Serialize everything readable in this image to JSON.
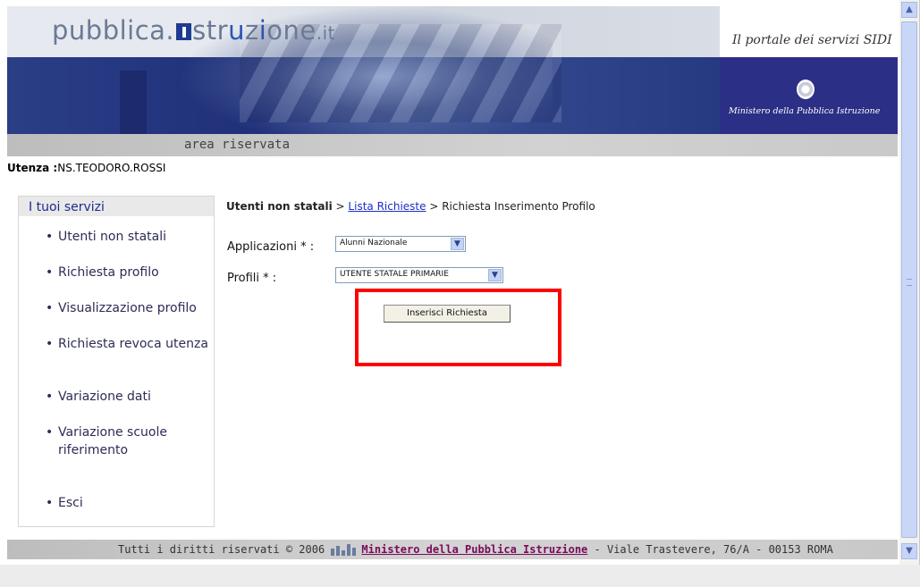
{
  "header": {
    "logo": {
      "part1": "pubblica.",
      "part2": "str",
      "part3": "u",
      "part4": "z",
      "part5": "i",
      "part6": "one",
      "tld": ".it"
    },
    "portal_tagline": "Il portale dei servizi SIDI",
    "ministry_signature": "Ministero della Pubblica Istruzione",
    "area_label": "area riservata"
  },
  "user": {
    "label": "Utenza :",
    "value": "NS.TEODORO.ROSSI"
  },
  "sidebar": {
    "title": "I tuoi servizi",
    "items": [
      {
        "label": "Utenti non statali"
      },
      {
        "label": "Richiesta profilo"
      },
      {
        "label": "Visualizzazione profilo"
      },
      {
        "label": "Richiesta revoca utenza"
      },
      {
        "label": "Variazione dati"
      },
      {
        "label": "Variazione scuole riferimento"
      },
      {
        "label": "Esci"
      }
    ]
  },
  "breadcrumb": {
    "root": "Utenti non statali",
    "sep1": " > ",
    "link": "Lista Richieste",
    "sep2": " > ",
    "current": "Richiesta Inserimento Profilo"
  },
  "form": {
    "applicazioni_label": "Applicazioni * :",
    "applicazioni_value": "Alunni Nazionale",
    "profili_label": "Profili * :",
    "profili_value": "UTENTE STATALE PRIMARIE",
    "submit_label": "Inserisci Richiesta"
  },
  "footer": {
    "copyright": "Tutti i diritti riservati © 2006",
    "ministry_link": "Ministero della Pubblica Istruzione",
    "address": " - Viale Trastevere, 76/A - 00153 ROMA"
  },
  "colors": {
    "accent_blue": "#2b2f85",
    "highlight_box": "#ff0000",
    "link": "#1a2ec9"
  }
}
